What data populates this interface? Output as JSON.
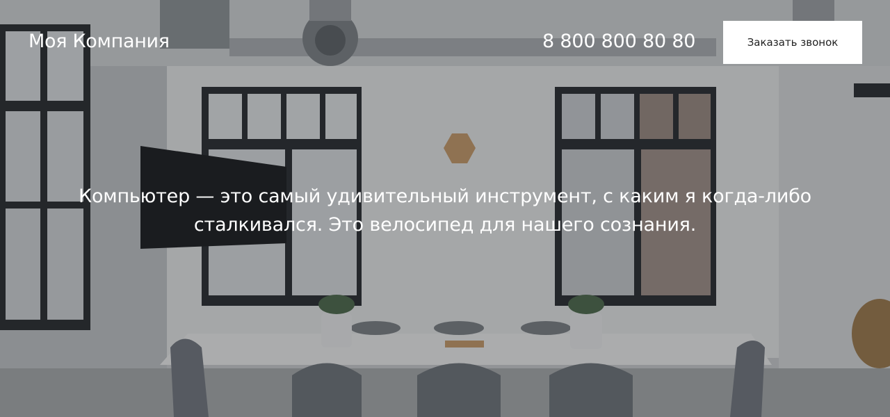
{
  "header": {
    "brand": "Моя Компания",
    "phone": "8 800 800 80 80",
    "cta_label": "Заказать звонок"
  },
  "hero": {
    "quote": "Компьютер — это самый удивительный инструмент, с каким я когда-либо сталкивался. Это велосипед для нашего сознания.",
    "background": "office-meeting-room-photo"
  },
  "colors": {
    "text": "#ffffff",
    "button_bg": "#ffffff",
    "button_text": "#222222"
  }
}
